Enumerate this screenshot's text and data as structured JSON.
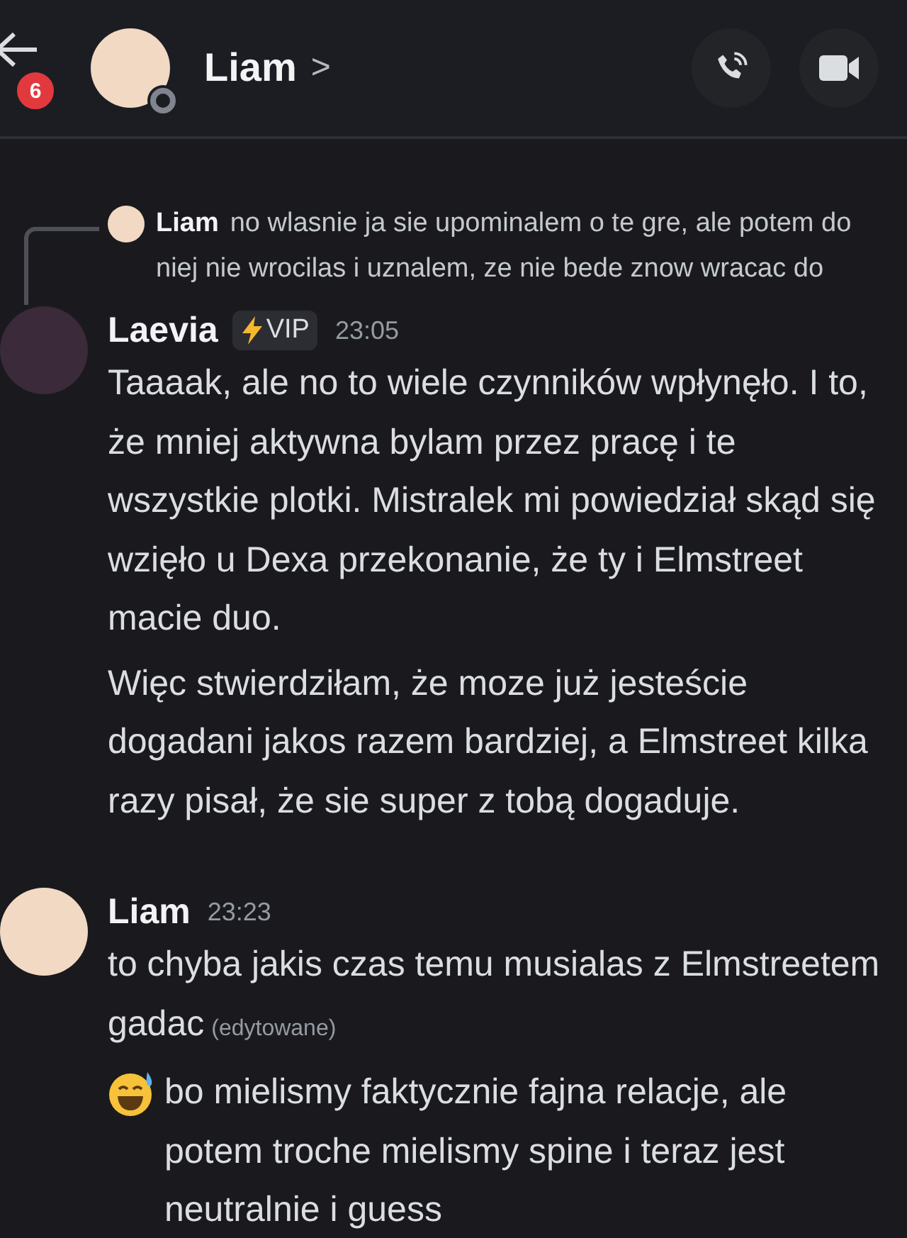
{
  "header": {
    "back_badge": "6",
    "contact_name": "Liam",
    "chevron": ">"
  },
  "reply": {
    "author": "Liam",
    "text": "no wlasnie ja sie upominalem o te gre, ale potem do niej nie wrocilas i uznalem, ze nie bede znow wracac do"
  },
  "messages": [
    {
      "author": "Laevia",
      "tag": "VIP",
      "time": "23:05",
      "paragraphs": [
        {
          "text": "Taaaak, ale no to wiele czynników wpłynęło. I to, że mniej aktywna bylam przez pracę i te wszystkie plotki. Mistralek mi powiedział skąd się wzięło u Dexa przekonanie, że ty i Elmstreet macie duo."
        },
        {
          "text": "Więc stwierdziłam, że moze już jesteście dogadani jakos razem bardziej, a Elmstreet kilka razy pisał, że sie super z tobą dogaduje."
        }
      ]
    },
    {
      "author": "Liam",
      "time": "23:23",
      "paragraphs": [
        {
          "text": "to chyba jakis czas temu musialas z Elmstreetem gadac",
          "edited": "(edytowane)"
        },
        {
          "text": "bo mielismy faktycznie fajna relacje, ale potem troche mielismy spine i teraz jest neutralnie i guess",
          "kind": "emoji-lead"
        }
      ]
    }
  ]
}
